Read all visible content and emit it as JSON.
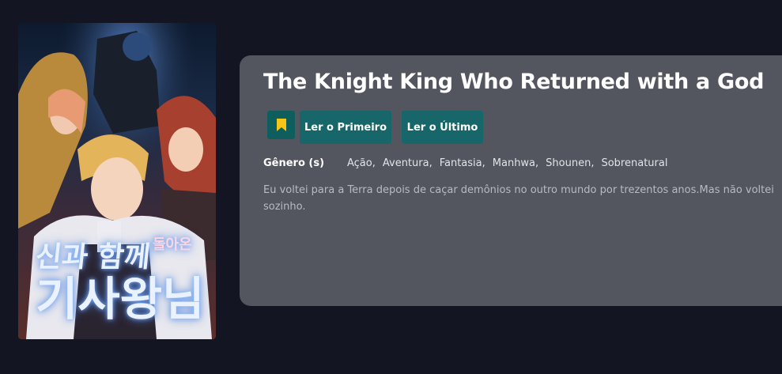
{
  "series": {
    "title": "The Knight King Who Returned with a God",
    "cover_title_line1": "신과 함께",
    "cover_title_small": "돌아온",
    "cover_title_line2": "기사왕님"
  },
  "actions": {
    "bookmark_icon": "bookmark-icon",
    "read_first_label": "Ler o Primeiro",
    "read_last_label": "Ler o Último"
  },
  "genre": {
    "label": "Gênero (s)",
    "items": [
      "Ação,",
      "Aventura,",
      "Fantasia,",
      "Manhwa,",
      "Shounen,",
      "Sobrenatural"
    ]
  },
  "synopsis": "Eu voltei para a Terra depois de caçar demônios no outro mundo por trezentos anos.Mas não voltei sozinho.",
  "colors": {
    "background": "#131523",
    "panel": "#54565f",
    "button": "#17676a",
    "bookmark": "#f5c518"
  }
}
